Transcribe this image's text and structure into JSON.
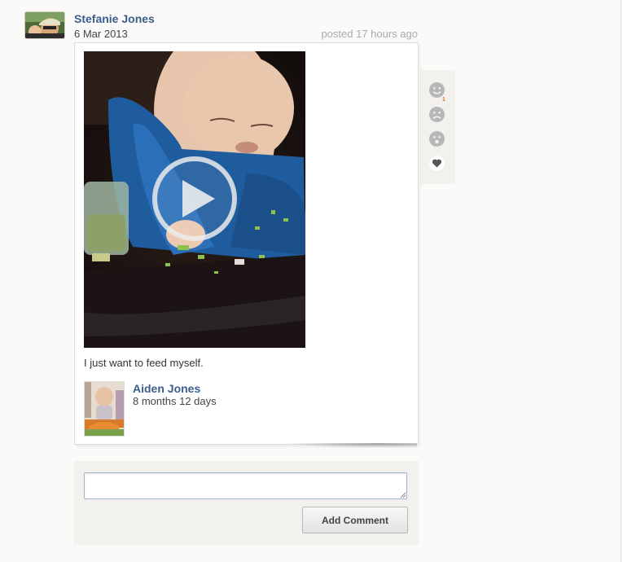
{
  "post": {
    "author": "Stefanie Jones",
    "date": "6 Mar 2013",
    "posted": "posted 17 hours ago",
    "caption": "I just want to feed myself.",
    "child": {
      "name": "Aiden Jones",
      "age": "8 months 12 days"
    }
  },
  "reactions": [
    {
      "icon": "smile-icon",
      "count": "1"
    },
    {
      "icon": "frown-icon"
    },
    {
      "icon": "surprised-icon"
    },
    {
      "icon": "heart-icon"
    }
  ],
  "comment": {
    "input_value": "",
    "button_label": "Add Comment"
  },
  "colors": {
    "link": "#3b5d8c",
    "background": "#fbfaf8",
    "count_badge": "#e8701a"
  }
}
